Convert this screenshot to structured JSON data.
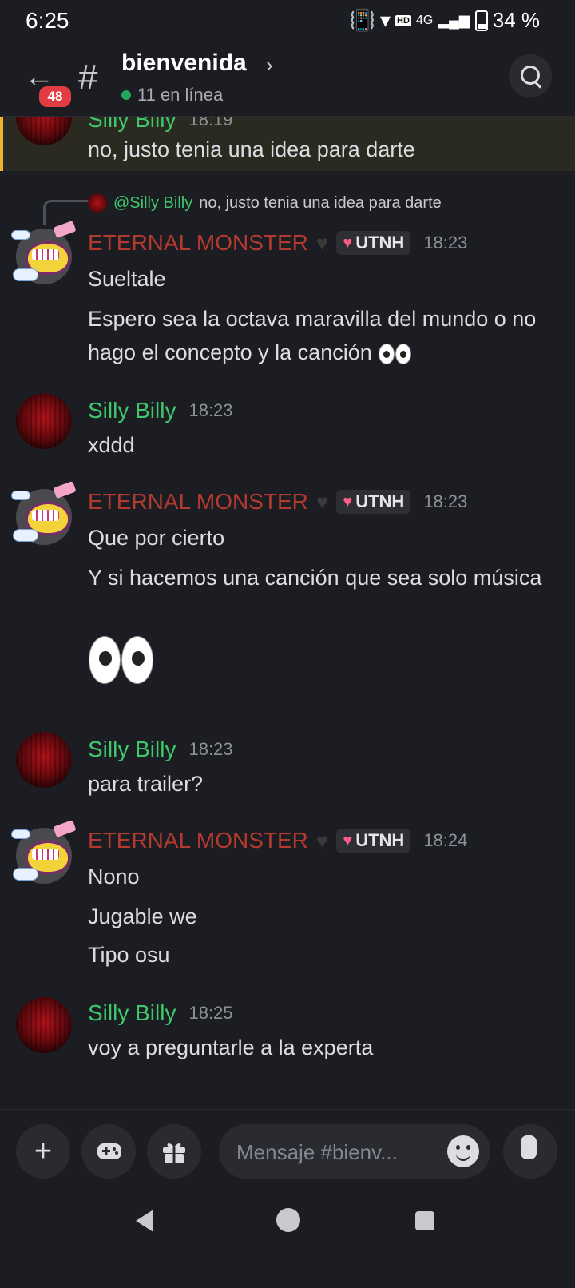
{
  "status_bar": {
    "time": "6:25",
    "network": "4G",
    "hd_label": "HD",
    "battery": "34 %"
  },
  "header": {
    "unread_badge": "48",
    "channel_name": "bienvenida",
    "online": "11 en línea"
  },
  "messages": [
    {
      "author": "Silly Billy",
      "time": "18:19",
      "lines": [
        "no, justo tenia una idea para darte"
      ],
      "highlighted": true
    },
    {
      "author": "ETERNAL MONSTER",
      "tag": "UTNH",
      "time": "18:23",
      "reply_to": {
        "mention": "@Silly Billy",
        "text": "no, justo tenia una idea para darte"
      },
      "lines": [
        "Sueltale",
        "Espero sea la octava maravilla del mundo o no hago el concepto y la canción"
      ]
    },
    {
      "author": "Silly Billy",
      "time": "18:23",
      "lines": [
        "xddd"
      ]
    },
    {
      "author": "ETERNAL MONSTER",
      "tag": "UTNH",
      "time": "18:23",
      "lines": [
        "Que por cierto",
        "Y si hacemos una canción que sea solo música"
      ],
      "emoji": "eyes"
    },
    {
      "author": "Silly Billy",
      "time": "18:23",
      "lines": [
        "para trailer?"
      ]
    },
    {
      "author": "ETERNAL MONSTER",
      "tag": "UTNH",
      "time": "18:24",
      "lines": [
        "Nono",
        "Jugable we",
        "Tipo osu"
      ]
    },
    {
      "author": "Silly Billy",
      "time": "18:25",
      "lines": [
        "voy a preguntarle a la experta"
      ]
    }
  ],
  "composer": {
    "placeholder": "Mensaje #bienv..."
  },
  "icons": {
    "back": "arrow-left-icon",
    "channel": "hash-icon",
    "search": "search-icon",
    "add": "plus-icon",
    "games": "gamepad-icon",
    "gift": "gift-icon",
    "emoji": "emoji-icon",
    "mic": "mic-icon"
  },
  "colors": {
    "background": "#1c1d22",
    "billy_name": "#3ec86b",
    "eternal_name": "#b33a2f",
    "badge": "#e03c41",
    "highlight_border": "#f0b232"
  }
}
